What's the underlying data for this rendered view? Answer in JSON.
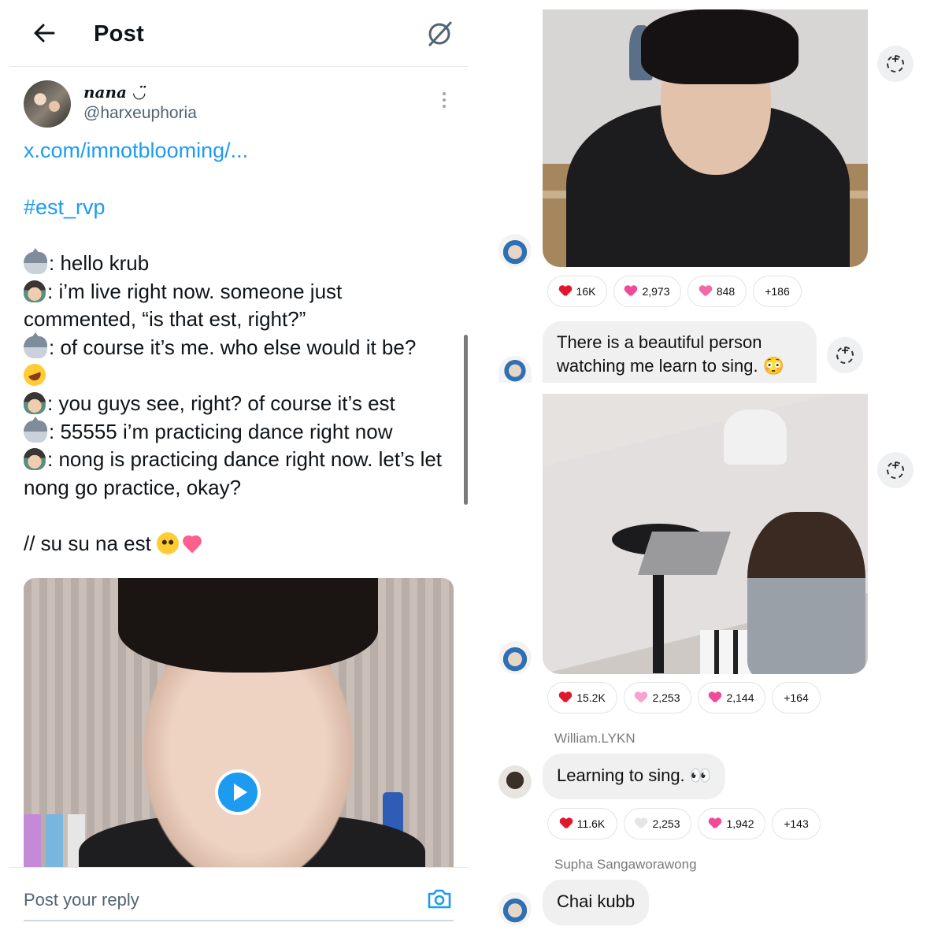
{
  "left": {
    "header": {
      "title": "Post"
    },
    "post": {
      "display_name": "nana ◡̈",
      "handle": "@harxeuphoria",
      "link": "x.com/imnotblooming/...",
      "hashtag": "#est_rvp",
      "lines": [
        {
          "icon": "shark-emoji",
          "text": ": hello krub"
        },
        {
          "icon": "man-emoji",
          "text": ": i’m live right now. someone just commented, “is that est, right?”"
        },
        {
          "icon": "shark-emoji",
          "text": ": of course it’s me. who else would it be?"
        },
        {
          "icon": "rofl-emoji",
          "text": ""
        },
        {
          "icon": "man-emoji",
          "text": ": you guys see, right? of course it’s est"
        },
        {
          "icon": "shark-emoji",
          "text": ": 55555 i’m practicing dance right now"
        },
        {
          "icon": "man-emoji",
          "text": ": nong is practicing dance right now. let’s let nong go practice, okay?"
        }
      ],
      "signoff": "// su su na est"
    },
    "reply": {
      "placeholder": "Post your reply"
    }
  },
  "right": {
    "bubble1": "There is a beautiful person watching me learn to sing. 😳",
    "reactions1": [
      {
        "heart": "#e0182d",
        "count": "16K"
      },
      {
        "heart": "#f04a9a",
        "count": "2,973"
      },
      {
        "heart": "#f06aa6",
        "count": "848"
      },
      {
        "heart": "",
        "count": "+186"
      }
    ],
    "reactions2": [
      {
        "heart": "#e0182d",
        "count": "15.2K"
      },
      {
        "heart": "#f7a3cc",
        "count": "2,253"
      },
      {
        "heart": "#f04a9a",
        "count": "2,144"
      },
      {
        "heart": "",
        "count": "+164"
      }
    ],
    "author1": "William.LYKN",
    "bubble2": "Learning to sing. 👀",
    "reactions3": [
      {
        "heart": "#e0182d",
        "count": "11.6K"
      },
      {
        "heart": "#e5e5e5",
        "count": "2,253"
      },
      {
        "heart": "#f04a9a",
        "count": "1,942"
      },
      {
        "heart": "",
        "count": "+143"
      }
    ],
    "author2": "Supha Sangaworawong",
    "bubble3": "Chai kubb"
  },
  "colors": {
    "link": "#1d9bf0",
    "text": "#0f1419",
    "muted": "#536471"
  }
}
